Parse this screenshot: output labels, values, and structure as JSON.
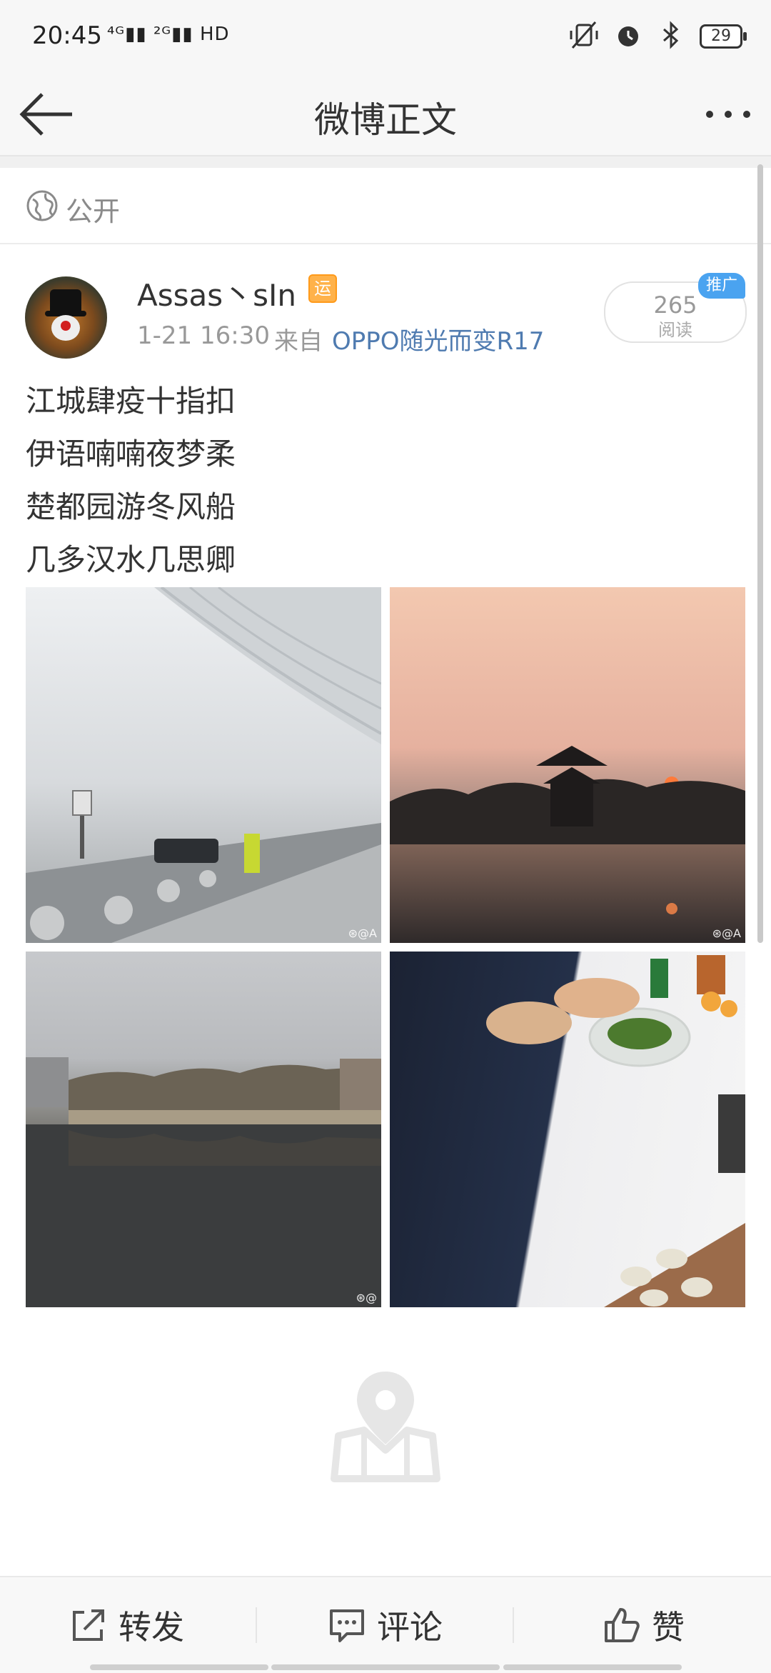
{
  "status_bar": {
    "time": "20:45",
    "network": "⁴ᴳ▮▮ ²ᴳ▮▮ HD",
    "battery": "29"
  },
  "header": {
    "title": "微博正文"
  },
  "visibility": {
    "label": "公开"
  },
  "post": {
    "username": "Assas丶sIn",
    "badge": "运",
    "time": "1-21 16:30",
    "from_label": "来自",
    "device": "OPPO随光而变R17",
    "read_count": "265",
    "read_label": "阅读",
    "promo_tag": "推广",
    "lines": [
      "江城肆疫十指扣",
      "伊语喃喃夜梦柔",
      "楚都园游冬风船",
      "几多汉水几思卿"
    ],
    "photos": [
      {
        "watermark": "⊛@A"
      },
      {
        "watermark": "⊛@A"
      },
      {
        "watermark": "⊛@"
      },
      {
        "watermark": ""
      }
    ]
  },
  "actions": {
    "repost": "转发",
    "comment": "评论",
    "like": "赞"
  }
}
